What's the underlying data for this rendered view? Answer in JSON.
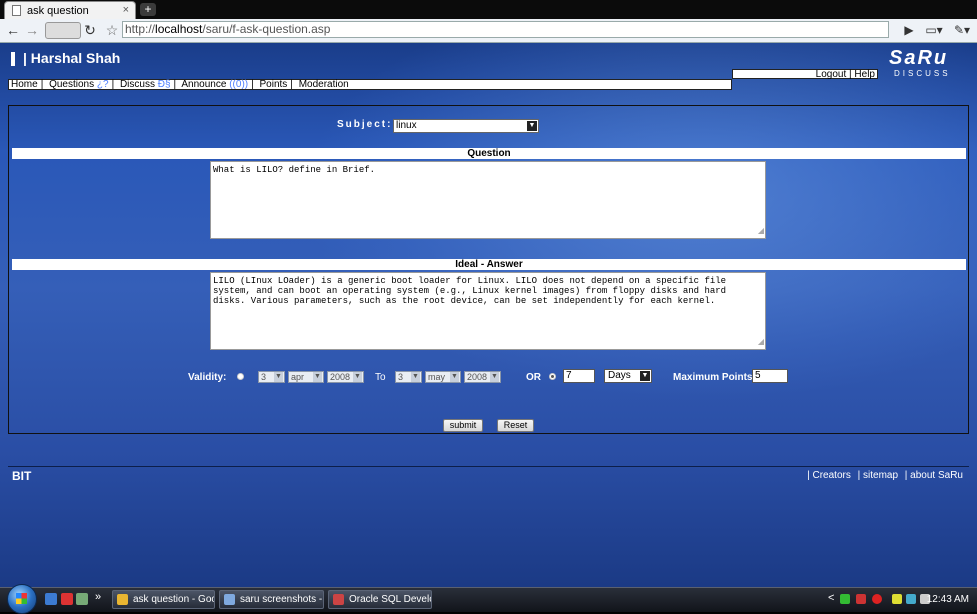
{
  "browser": {
    "tab_title": "ask question",
    "tab_close": "×",
    "new_tab": "+",
    "url_prefix": "http://",
    "url_host": "localhost",
    "url_path": "/saru/f-ask-question.asp",
    "icons": [
      "back-arrow-icon",
      "forward-arrow-icon",
      "reload-icon",
      "star-icon",
      "go-icon",
      "page-menu-icon",
      "wrench-icon"
    ]
  },
  "header": {
    "user_name": "| Harshal Shah",
    "logo_mark": "SaRu",
    "logo_sub": "DISCUSS",
    "logout": "Logout",
    "help": "Help",
    "auth_sep": " | "
  },
  "nav": {
    "items": [
      {
        "label": "Home",
        "badge": ""
      },
      {
        "label": "Questions",
        "badge": "¿?"
      },
      {
        "label": "Discuss",
        "badge": "Ð§"
      },
      {
        "label": "Announce",
        "badge": "((0))"
      },
      {
        "label": "Points",
        "badge": ""
      },
      {
        "label": "Moderation",
        "badge": ""
      }
    ],
    "sep": "|"
  },
  "form": {
    "subject_label": "Subject:",
    "subject_value": "linux",
    "question_band": "Question",
    "question_text": "What is LILO? define in Brief.",
    "answer_band": "Ideal - Answer",
    "answer_text": "LILO (LInux LOader) is a generic boot loader for Linux. LILO does not depend on a specific file\nsystem, and can boot an operating system (e.g., Linux kernel images) from floppy disks and hard\ndisks. Various parameters, such as the root device, can be set independently for each kernel.",
    "validity_label": "Validity:",
    "from_day": "3",
    "from_month": "apr",
    "from_year": "2008",
    "to_label": "To",
    "to_day": "3",
    "to_month": "may",
    "to_year": "2008",
    "or_label": "OR",
    "duration_value": "7",
    "duration_unit": "Days",
    "max_points_label": "Maximum Points :",
    "max_points_value": "5",
    "submit": "submit",
    "reset": "Reset"
  },
  "footer": {
    "brand": "BIT",
    "links": [
      "| Creators",
      "| sitemap",
      "| about SaRu"
    ]
  },
  "taskbar": {
    "chevron": "»",
    "tasks": [
      "ask question - Goog...",
      "saru screenshots - ...",
      "Oracle SQL Developer"
    ],
    "tray_chevron": "<",
    "clock": "12:43 AM"
  }
}
